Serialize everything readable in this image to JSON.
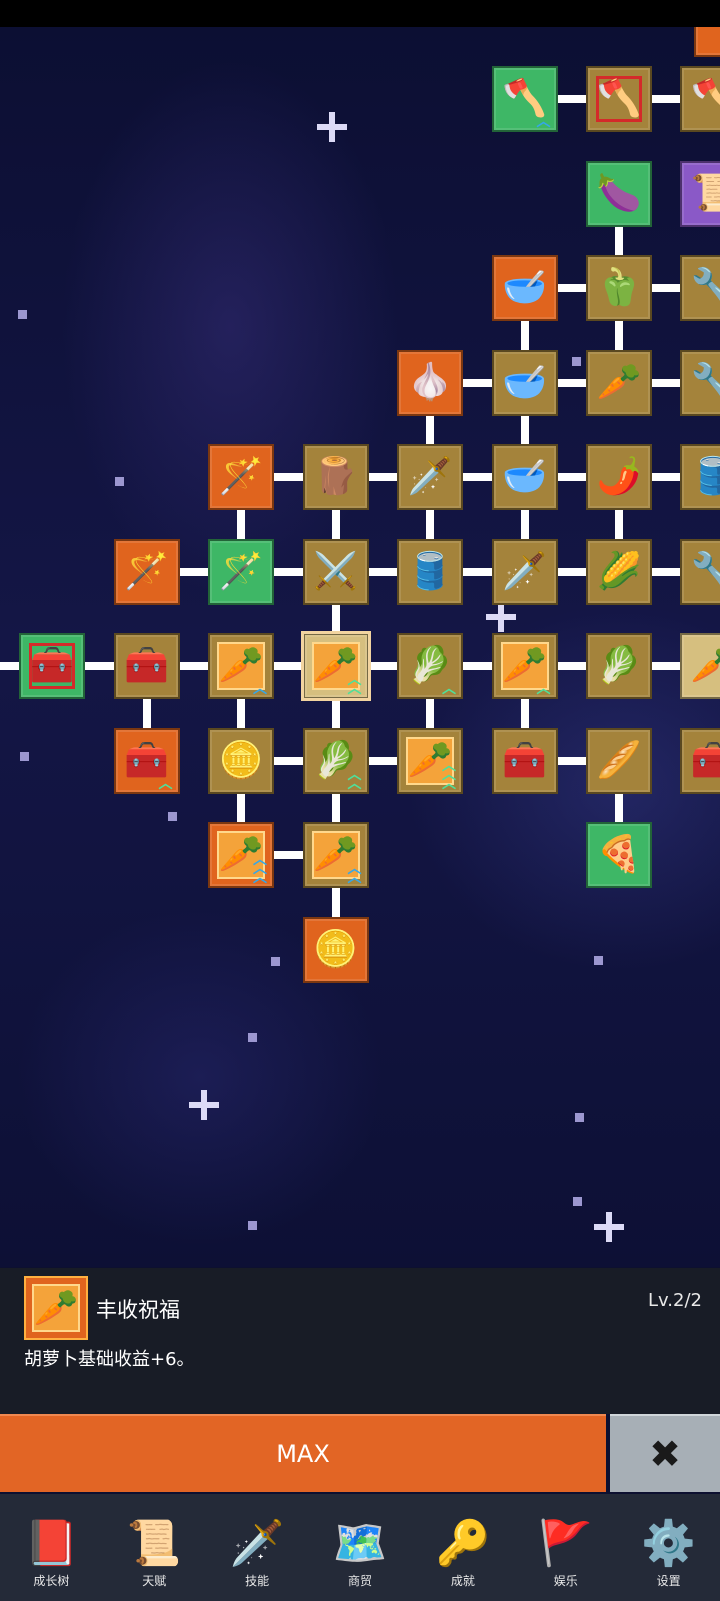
{
  "tree": {
    "nodes": [
      {
        "row": 0,
        "col": 5,
        "color": "green",
        "icon": "shovel-icon",
        "glyph": "🪓",
        "level": "blue-one"
      },
      {
        "row": 0,
        "col": 6,
        "color": "brown",
        "icon": "shovel-icon",
        "glyph": "🪓",
        "redbox": true
      },
      {
        "row": 0,
        "col": 7,
        "color": "brown",
        "icon": "shovel-icon",
        "glyph": "🪓",
        "partial": true
      },
      {
        "row": 1,
        "col": 6,
        "color": "green",
        "icon": "eggplant-icon",
        "glyph": "🍆"
      },
      {
        "row": 1,
        "col": 7,
        "color": "purple",
        "icon": "scroll-icon",
        "glyph": "📜",
        "partial": true
      },
      {
        "row": 2,
        "col": 5,
        "color": "orange",
        "icon": "bowl-icon",
        "glyph": "🥣"
      },
      {
        "row": 2,
        "col": 6,
        "color": "brown",
        "icon": "green-pepper-icon",
        "glyph": "🫑"
      },
      {
        "row": 2,
        "col": 7,
        "color": "brown",
        "icon": "tool-icon",
        "glyph": "🔧",
        "partial": true
      },
      {
        "row": 3,
        "col": 4,
        "color": "orange",
        "icon": "garlic-icon",
        "glyph": "🧄"
      },
      {
        "row": 3,
        "col": 5,
        "color": "brown",
        "icon": "soup-bowl-icon",
        "glyph": "🥣"
      },
      {
        "row": 3,
        "col": 6,
        "color": "brown",
        "icon": "radish-icon",
        "glyph": "🥕"
      },
      {
        "row": 3,
        "col": 7,
        "color": "brown",
        "icon": "tool-icon",
        "glyph": "🔧",
        "partial": true
      },
      {
        "row": 4,
        "col": 2,
        "color": "orange",
        "icon": "blue-staff-icon",
        "glyph": "🪄"
      },
      {
        "row": 4,
        "col": 3,
        "color": "brown",
        "icon": "wooden-crate-icon",
        "glyph": "🪵"
      },
      {
        "row": 4,
        "col": 4,
        "color": "brown",
        "icon": "golden-sword-icon",
        "glyph": "🗡️"
      },
      {
        "row": 4,
        "col": 5,
        "color": "brown",
        "icon": "bowl-icon",
        "glyph": "🥣"
      },
      {
        "row": 4,
        "col": 6,
        "color": "brown",
        "icon": "chili-pepper-icon",
        "glyph": "🌶️"
      },
      {
        "row": 4,
        "col": 7,
        "color": "brown",
        "icon": "barrel-icon",
        "glyph": "🛢️",
        "partial": true
      },
      {
        "row": 5,
        "col": 1,
        "color": "orange",
        "icon": "red-staff-icon",
        "glyph": "🪄"
      },
      {
        "row": 5,
        "col": 2,
        "color": "green",
        "icon": "green-staff-icon",
        "glyph": "🪄"
      },
      {
        "row": 5,
        "col": 3,
        "color": "brown",
        "icon": "iron-sword-icon",
        "glyph": "⚔️"
      },
      {
        "row": 5,
        "col": 4,
        "color": "brown",
        "icon": "barrel-icon",
        "glyph": "🛢️"
      },
      {
        "row": 5,
        "col": 5,
        "color": "brown",
        "icon": "broad-sword-icon",
        "glyph": "🗡️"
      },
      {
        "row": 5,
        "col": 6,
        "color": "brown",
        "icon": "corn-icon",
        "glyph": "🌽"
      },
      {
        "row": 5,
        "col": 7,
        "color": "brown",
        "icon": "tool-icon",
        "glyph": "🔧",
        "partial": true
      },
      {
        "row": 6,
        "col": 0,
        "color": "green",
        "icon": "chest-icon",
        "glyph": "🧰",
        "redbox": true
      },
      {
        "row": 6,
        "col": 1,
        "color": "brown",
        "icon": "chest-icon",
        "glyph": "🧰"
      },
      {
        "row": 6,
        "col": 2,
        "color": "brown",
        "icon": "carrot-icon",
        "glyph": "🥕",
        "inner": true,
        "level": "blue-one"
      },
      {
        "row": 6,
        "col": 3,
        "color": "tan",
        "icon": "carrot-icon",
        "glyph": "🥕",
        "inner": true,
        "level": "green-two",
        "selected": true
      },
      {
        "row": 6,
        "col": 4,
        "color": "brown",
        "icon": "cabbage-icon",
        "glyph": "🥬",
        "level": "green-one"
      },
      {
        "row": 6,
        "col": 5,
        "color": "brown",
        "icon": "carrot-icon",
        "glyph": "🥕",
        "inner": true,
        "level": "green-one"
      },
      {
        "row": 6,
        "col": 6,
        "color": "brown",
        "icon": "cabbage-icon",
        "glyph": "🥬"
      },
      {
        "row": 6,
        "col": 7,
        "color": "tan",
        "icon": "carrot-icon",
        "glyph": "🥕",
        "partial": true
      },
      {
        "row": 7,
        "col": 1,
        "color": "orange",
        "icon": "chest-icon",
        "glyph": "🧰",
        "level": "green-one"
      },
      {
        "row": 7,
        "col": 2,
        "color": "brown",
        "icon": "gold-coin-icon",
        "glyph": "🪙"
      },
      {
        "row": 7,
        "col": 3,
        "color": "brown",
        "icon": "cabbage-icon",
        "glyph": "🥬",
        "level": "green-two"
      },
      {
        "row": 7,
        "col": 4,
        "color": "brown",
        "icon": "carrot-icon",
        "glyph": "🥕",
        "inner": true,
        "level": "green-three"
      },
      {
        "row": 7,
        "col": 5,
        "color": "brown",
        "icon": "treasure-chest-icon",
        "glyph": "🧰"
      },
      {
        "row": 7,
        "col": 6,
        "color": "brown",
        "icon": "parsnip-icon",
        "glyph": "🥖"
      },
      {
        "row": 7,
        "col": 7,
        "color": "brown",
        "icon": "chest-icon",
        "glyph": "🧰",
        "partial": true
      },
      {
        "row": 8,
        "col": 2,
        "color": "orange",
        "icon": "carrot-icon",
        "glyph": "🥕",
        "inner": true,
        "level": "blue-three"
      },
      {
        "row": 8,
        "col": 3,
        "color": "brown",
        "icon": "carrot-icon",
        "glyph": "🥕",
        "inner": true,
        "level": "blue-two"
      },
      {
        "row": 8,
        "col": 6,
        "color": "green",
        "icon": "pizza-icon",
        "glyph": "🍕"
      },
      {
        "row": 9,
        "col": 3,
        "color": "orange",
        "icon": "gold-coin-icon",
        "glyph": "🪙"
      }
    ],
    "h_links": [
      [
        0,
        5,
        6
      ],
      [
        0,
        6,
        7
      ],
      [
        2,
        5,
        6
      ],
      [
        2,
        6,
        7
      ],
      [
        3,
        4,
        5
      ],
      [
        3,
        5,
        6
      ],
      [
        3,
        6,
        7
      ],
      [
        4,
        2,
        3
      ],
      [
        4,
        3,
        4
      ],
      [
        4,
        4,
        5
      ],
      [
        4,
        5,
        6
      ],
      [
        4,
        6,
        7
      ],
      [
        5,
        1,
        2
      ],
      [
        5,
        2,
        3
      ],
      [
        5,
        3,
        4
      ],
      [
        5,
        4,
        5
      ],
      [
        5,
        5,
        6
      ],
      [
        5,
        6,
        7
      ],
      [
        6,
        -1,
        0
      ],
      [
        6,
        0,
        1
      ],
      [
        6,
        1,
        2
      ],
      [
        6,
        2,
        3
      ],
      [
        6,
        3,
        4
      ],
      [
        6,
        4,
        5
      ],
      [
        6,
        5,
        6
      ],
      [
        6,
        6,
        7
      ],
      [
        7,
        2,
        3
      ],
      [
        7,
        3,
        4
      ],
      [
        7,
        5,
        6
      ],
      [
        8,
        2,
        3
      ]
    ],
    "v_links": [
      [
        6,
        1,
        2
      ],
      [
        6,
        2,
        3
      ],
      [
        5,
        2,
        3
      ],
      [
        5,
        3,
        4
      ],
      [
        4,
        3,
        4
      ],
      [
        4,
        4,
        5
      ],
      [
        3,
        4,
        5
      ],
      [
        2,
        4,
        5
      ],
      [
        5,
        4,
        5
      ],
      [
        6,
        4,
        5
      ],
      [
        3,
        5,
        6
      ],
      [
        1,
        6,
        7
      ],
      [
        2,
        6,
        7
      ],
      [
        3,
        6,
        7
      ],
      [
        4,
        6,
        7
      ],
      [
        5,
        6,
        7
      ],
      [
        2,
        7,
        8
      ],
      [
        3,
        7,
        8
      ],
      [
        3,
        8,
        9
      ],
      [
        6,
        7,
        8
      ]
    ]
  },
  "info_panel": {
    "title": "丰收祝福",
    "level": "Lv.2/2",
    "description": "胡萝卜基础收益+6。",
    "icon": "carrot-icon",
    "icon_glyph": "🥕"
  },
  "actions": {
    "max_label": "MAX",
    "close_icon": "close-icon",
    "close_glyph": "✖"
  },
  "bottom_nav": [
    {
      "id": "growth-tree",
      "label": "成长树",
      "icon": "book-icon",
      "glyph": "📕"
    },
    {
      "id": "talent",
      "label": "天赋",
      "icon": "scroll-icon",
      "glyph": "📜"
    },
    {
      "id": "skill",
      "label": "技能",
      "icon": "sword-icon",
      "glyph": "🗡️"
    },
    {
      "id": "trade",
      "label": "商贸",
      "icon": "map-icon",
      "glyph": "🗺️"
    },
    {
      "id": "achievement",
      "label": "成就",
      "icon": "key-icon",
      "glyph": "🔑"
    },
    {
      "id": "entertainment",
      "label": "娱乐",
      "icon": "banner-icon",
      "glyph": "🚩"
    },
    {
      "id": "settings",
      "label": "设置",
      "icon": "gear-icon",
      "glyph": "⚙️"
    }
  ],
  "colors": {
    "orange": "#e0641e",
    "green": "#3eb766",
    "brown": "#a4833b",
    "purple": "#8a59c7",
    "tan": "#d6bf7f",
    "max_button": "#e26525",
    "close_button": "#a7afb6",
    "info_panel": "#181c26",
    "nav_bar": "#242a38"
  }
}
